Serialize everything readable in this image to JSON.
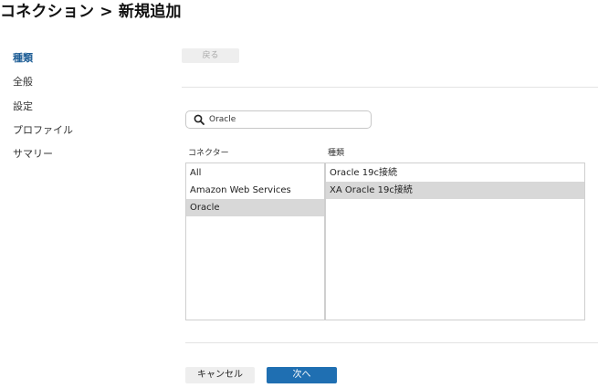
{
  "page": {
    "title": "コネクション > 新規追加"
  },
  "sidebar": {
    "items": [
      {
        "label": "種類",
        "active": true
      },
      {
        "label": "全般",
        "active": false
      },
      {
        "label": "設定",
        "active": false
      },
      {
        "label": "プロファイル",
        "active": false
      },
      {
        "label": "サマリー",
        "active": false
      }
    ]
  },
  "toolbar": {
    "back_label": "戻る"
  },
  "search": {
    "value": "Oracle",
    "icon": "search-icon"
  },
  "connectors": {
    "header": "コネクター",
    "items": [
      "All",
      "Amazon Web Services",
      "Oracle"
    ],
    "selected": "Oracle"
  },
  "types": {
    "header": "種類",
    "items": [
      "Oracle 19c接続",
      "XA Oracle 19c接続"
    ],
    "selected": "XA Oracle 19c接続"
  },
  "footer": {
    "cancel_label": "キャンセル",
    "next_label": "次へ"
  },
  "colors": {
    "accent": "#1f6fb2",
    "active_nav": "#1f5e96",
    "selection": "#d8d8d8"
  }
}
